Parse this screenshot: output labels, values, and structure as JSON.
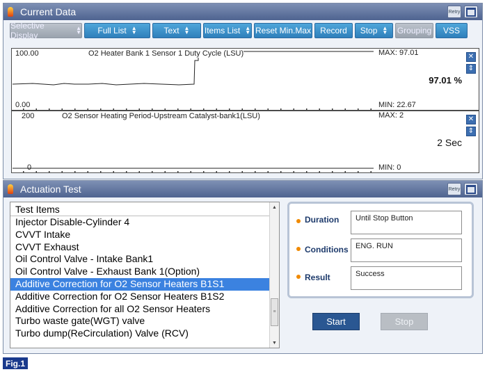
{
  "current_data": {
    "title": "Current Data",
    "retry_label": "Retry",
    "toolbar": [
      {
        "label": "Selective Display",
        "spinner": true,
        "disabled": true,
        "name": "selective-display"
      },
      {
        "label": "Full List",
        "spinner": true,
        "disabled": false,
        "name": "full-list"
      },
      {
        "label": "Text",
        "spinner": true,
        "disabled": false,
        "name": "text"
      },
      {
        "label": "Items List",
        "spinner": true,
        "disabled": false,
        "name": "items-list"
      },
      {
        "label": "Reset Min.Max",
        "spinner": false,
        "disabled": false,
        "name": "reset-min-max"
      },
      {
        "label": "Record",
        "spinner": false,
        "disabled": false,
        "name": "record"
      },
      {
        "label": "Stop",
        "spinner": true,
        "disabled": false,
        "name": "stop"
      },
      {
        "label": "Grouping",
        "spinner": false,
        "disabled": true,
        "name": "grouping"
      },
      {
        "label": "VSS",
        "spinner": false,
        "disabled": false,
        "name": "vss"
      }
    ],
    "graph1": {
      "title": "O2 Heater Bank 1 Sensor 1 Duty Cycle (LSU)",
      "ymax_label": "100.00",
      "ymin_label": "0.00",
      "max": "MAX: 97.01",
      "min": "MIN: 22.67",
      "current": "97.01 %"
    },
    "graph2": {
      "title": "O2 Sensor Heating Period-Upstream Catalyst-bank1(LSU)",
      "ymax_label": "200",
      "ymin_label": "0",
      "max": "MAX: 2",
      "min": "MIN: 0",
      "current": "2 Sec"
    }
  },
  "actuation_test": {
    "title": "Actuation Test",
    "retry_label": "Retry",
    "list_header": "Test Items",
    "items": [
      "Injector Disable-Cylinder 4",
      "CVVT Intake",
      "CVVT Exhaust",
      "Oil Control Valve - Intake Bank1",
      "Oil Control Valve - Exhaust Bank 1(Option)",
      "Additive Correction for O2 Sensor Heaters B1S1",
      "Additive Correction for O2 Sensor Heaters B1S2",
      "Additive Correction for all O2 Sensor Heaters",
      "Turbo waste gate(WGT) valve",
      "Turbo dump(ReCirculation) Valve (RCV)"
    ],
    "selected_index": 5,
    "duration_label": "Duration",
    "duration_value": "Until Stop Button",
    "conditions_label": "Conditions",
    "conditions_value": "ENG. RUN",
    "result_label": "Result",
    "result_value": "Success",
    "start_label": "Start",
    "stop_label": "Stop"
  },
  "figure_label": "Fig.1",
  "colors": {
    "title_bar": "#5a6e98",
    "button_blue": "#3a8fcc",
    "selected_row": "#3b82e0",
    "start_button": "#2a5792",
    "stop_button_disabled": "#b9bec4",
    "fig_label": "#1a3a8c"
  }
}
